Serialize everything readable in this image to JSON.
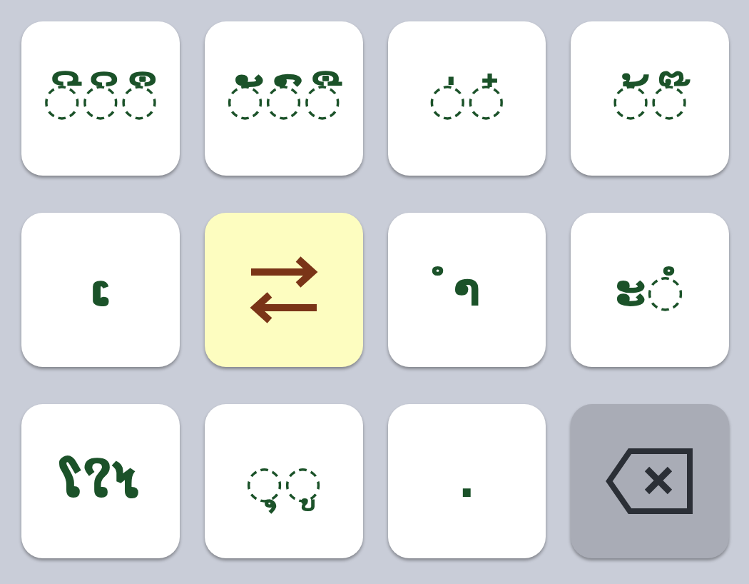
{
  "keyboard": {
    "rows": [
      {
        "keys": [
          {
            "kind": "char",
            "label": "◌ີ◌ິ◌ຶ"
          },
          {
            "kind": "char",
            "label": "◌ັ◌ົ◌ື"
          },
          {
            "kind": "char",
            "label": "◌່◌໋"
          },
          {
            "kind": "char",
            "label": "◌້◌໊"
          }
        ]
      },
      {
        "keys": [
          {
            "kind": "char",
            "label": "ເ"
          },
          {
            "kind": "swap"
          },
          {
            "kind": "char",
            "label": "ຳ"
          },
          {
            "kind": "char",
            "label": "ະ◌ໍ"
          }
        ]
      },
      {
        "keys": [
          {
            "kind": "char",
            "label": "ໂໃໄ"
          },
          {
            "kind": "char",
            "label": "◌ຸ◌ູ"
          },
          {
            "kind": "char",
            "label": "."
          },
          {
            "kind": "backspace"
          }
        ]
      }
    ]
  }
}
